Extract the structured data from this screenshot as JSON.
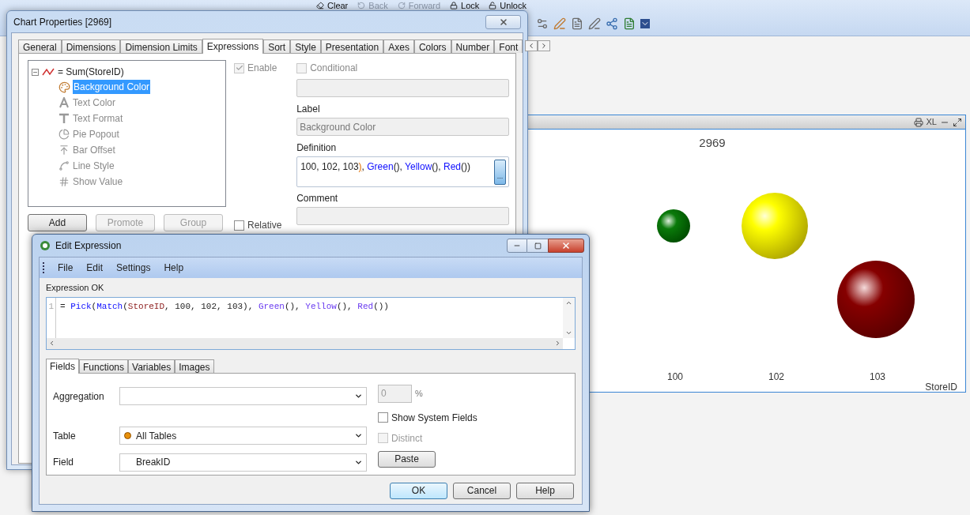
{
  "toolbar": {
    "items": [
      {
        "label": "Clear",
        "disabled": false
      },
      {
        "label": "Back",
        "disabled": true
      },
      {
        "label": "Forward",
        "disabled": true
      },
      {
        "label": "Lock",
        "disabled": false
      },
      {
        "label": "Unlock",
        "disabled": false
      }
    ]
  },
  "chart_window": {
    "xl": "XL",
    "title": "2969",
    "categories": [
      "100",
      "102",
      "103"
    ],
    "axis_label": "StoreID"
  },
  "chart_properties": {
    "title": "Chart Properties [2969]",
    "tabs": [
      {
        "label": "General",
        "selected": false
      },
      {
        "label": "Dimensions",
        "selected": false
      },
      {
        "label": "Dimension Limits",
        "selected": false
      },
      {
        "label": "Expressions",
        "selected": true
      },
      {
        "label": "Sort",
        "selected": false
      },
      {
        "label": "Style",
        "selected": false
      },
      {
        "label": "Presentation",
        "selected": false
      },
      {
        "label": "Axes",
        "selected": false
      },
      {
        "label": "Colors",
        "selected": false
      },
      {
        "label": "Number",
        "selected": false
      },
      {
        "label": "Font",
        "selected": false
      }
    ],
    "tree": {
      "label": "= Sum(StoreID)",
      "expanded": true,
      "children": [
        {
          "label": "Background Color",
          "kind": "palette",
          "selected": true,
          "disabled": false
        },
        {
          "label": "Text Color",
          "kind": "letter-a",
          "selected": false,
          "disabled": true
        },
        {
          "label": "Text Format",
          "kind": "letter-t",
          "selected": false,
          "disabled": true
        },
        {
          "label": "Pie Popout",
          "kind": "pie",
          "selected": false,
          "disabled": true
        },
        {
          "label": "Bar Offset",
          "kind": "offset",
          "selected": false,
          "disabled": true
        },
        {
          "label": "Line Style",
          "kind": "line",
          "selected": false,
          "disabled": true
        },
        {
          "label": "Show Value",
          "kind": "value",
          "selected": false,
          "disabled": true
        }
      ]
    },
    "enable": {
      "label": "Enable",
      "checked": true,
      "disabled": true
    },
    "conditional": {
      "label": "Conditional",
      "checked": false,
      "disabled": true
    },
    "label_heading": "Label",
    "label_value": "Background Color",
    "definition_heading": "Definition",
    "definition": [
      {
        "text": "100, 102, 103",
        "kind": "plain"
      },
      {
        "text": ")",
        "kind": "brace"
      },
      {
        "text": ", ",
        "kind": "plain"
      },
      {
        "text": "Green",
        "kind": "function"
      },
      {
        "text": "(), ",
        "kind": "plain"
      },
      {
        "text": "Yellow",
        "kind": "function"
      },
      {
        "text": "(), ",
        "kind": "plain"
      },
      {
        "text": "Red",
        "kind": "function"
      },
      {
        "text": "())",
        "kind": "plain"
      }
    ],
    "definition_button": "...",
    "comment_heading": "Comment",
    "buttons": [
      {
        "label": "Add",
        "disabled": false
      },
      {
        "label": "Promote",
        "disabled": true
      },
      {
        "label": "Group",
        "disabled": true
      }
    ],
    "relative": {
      "label": "Relative",
      "checked": false
    }
  },
  "edit_expression": {
    "title": "Edit Expression",
    "menu": [
      "File",
      "Edit",
      "Settings",
      "Help"
    ],
    "status": "Expression OK",
    "line_number": "1",
    "code": [
      {
        "text": "= ",
        "kind": "plain"
      },
      {
        "text": "Pick",
        "kind": "function"
      },
      {
        "text": "(",
        "kind": "plain"
      },
      {
        "text": "Match",
        "kind": "function"
      },
      {
        "text": "(",
        "kind": "plain"
      },
      {
        "text": "StoreID",
        "kind": "field"
      },
      {
        "text": ", 100, 102, 103), ",
        "kind": "plain"
      },
      {
        "text": "Green",
        "kind": "color_function"
      },
      {
        "text": "(), ",
        "kind": "plain"
      },
      {
        "text": "Yellow",
        "kind": "color_function"
      },
      {
        "text": "(), ",
        "kind": "plain"
      },
      {
        "text": "Red",
        "kind": "color_function"
      },
      {
        "text": "())",
        "kind": "plain"
      }
    ],
    "tabs": [
      {
        "label": "Fields",
        "selected": true
      },
      {
        "label": "Functions",
        "selected": false
      },
      {
        "label": "Variables",
        "selected": false
      },
      {
        "label": "Images",
        "selected": false
      }
    ],
    "aggregation": {
      "label": "Aggregation"
    },
    "percent": {
      "value": "0",
      "unit": "%",
      "disabled": true
    },
    "table": {
      "label": "Table",
      "value": "All Tables"
    },
    "show_system_fields": {
      "label": "Show System Fields",
      "checked": false,
      "disabled": false
    },
    "field": {
      "label": "Field",
      "value": "BreakID"
    },
    "distinct": {
      "label": "Distinct",
      "checked": false,
      "disabled": true
    },
    "paste": "Paste",
    "buttons": [
      {
        "label": "OK",
        "default": true
      },
      {
        "label": "Cancel",
        "default": false
      },
      {
        "label": "Help",
        "default": false
      }
    ]
  }
}
